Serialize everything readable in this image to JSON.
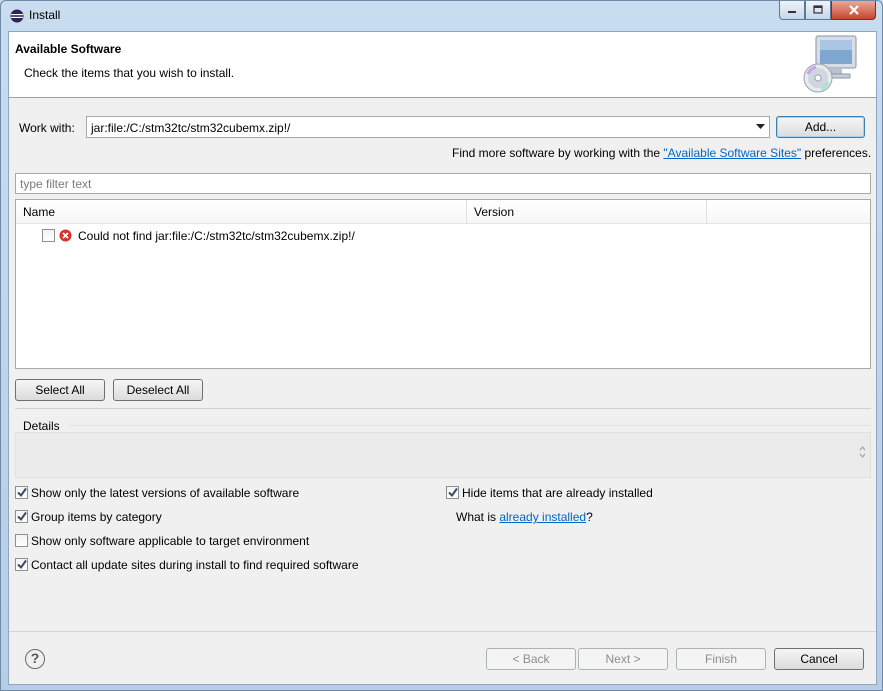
{
  "window": {
    "title": "Install",
    "controls": {
      "minimize_icon": "minimize-icon",
      "maximize_icon": "maximize-icon",
      "close_icon": "close-icon"
    }
  },
  "banner": {
    "title": "Available Software",
    "description": "Check the items that you wish to install."
  },
  "work_with": {
    "label": "Work with:",
    "value": "jar:file:/C:/stm32tc/stm32cubemx.zip!/",
    "add_button": "Add...",
    "find_more_prefix": "Find more software by working with the ",
    "find_more_link": "\"Available Software Sites\"",
    "find_more_suffix": " preferences."
  },
  "filter": {
    "placeholder": "type filter text"
  },
  "tree": {
    "columns": [
      "Name",
      "Version"
    ],
    "rows": [
      {
        "checked": false,
        "icon": "error-icon",
        "name": "Could not find jar:file:/C:/stm32tc/stm32cubemx.zip!/",
        "version": ""
      }
    ]
  },
  "selection_buttons": {
    "select_all": "Select All",
    "deselect_all": "Deselect All"
  },
  "details": {
    "label": "Details"
  },
  "options": {
    "latest_versions": {
      "label": "Show only the latest versions of available software",
      "checked": true
    },
    "group_by_category": {
      "label": "Group items by category",
      "checked": true
    },
    "applicable_only": {
      "label": "Show only software applicable to target environment",
      "checked": false
    },
    "contact_all_sites": {
      "label": "Contact all update sites during install to find required software",
      "checked": true
    },
    "hide_installed": {
      "label": "Hide items that are already installed",
      "checked": true
    },
    "what_is_prefix": "What is ",
    "what_is_link": "already installed",
    "what_is_suffix": "?"
  },
  "footer": {
    "help": "?",
    "back": "< Back",
    "next": "Next >",
    "finish": "Finish",
    "cancel": "Cancel"
  }
}
